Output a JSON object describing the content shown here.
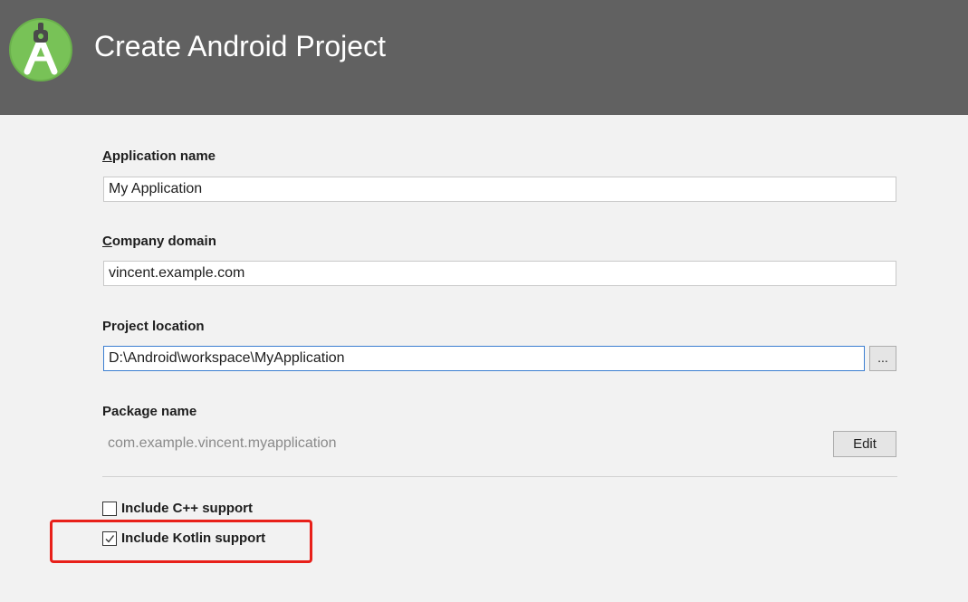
{
  "header": {
    "title": "Create Android Project",
    "background_color": "#616161",
    "logo_icon": "android-studio-logo-icon"
  },
  "form": {
    "application_name": {
      "label": "Application name",
      "value": "My Application"
    },
    "company_domain": {
      "label": "Company domain",
      "value": "vincent.example.com"
    },
    "project_location": {
      "label": "Project location",
      "value": "D:\\Android\\workspace\\MyApplication",
      "browse_label": "..."
    },
    "package_name": {
      "label": "Package name",
      "value": "com.example.vincent.myapplication",
      "edit_label": "Edit"
    }
  },
  "options": {
    "cpp_support": {
      "label": "Include C++ support",
      "checked": false
    },
    "kotlin_support": {
      "label": "Include Kotlin support",
      "checked": true
    }
  },
  "annotation": {
    "highlight_color": "#e8201a"
  }
}
